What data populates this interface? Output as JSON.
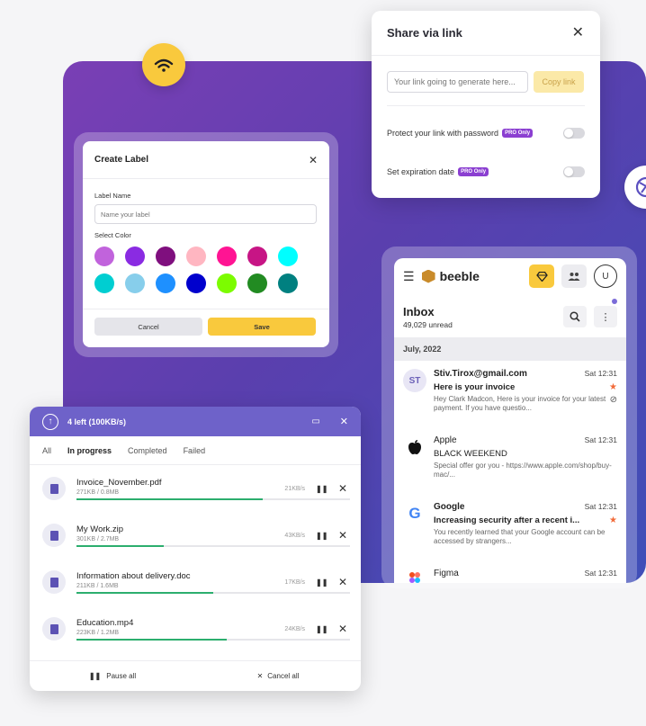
{
  "share": {
    "title": "Share via link",
    "link_placeholder": "Your link going to generate here...",
    "copy_label": "Copy link",
    "protect_label": "Protect your link with password",
    "expire_label": "Set expiration date",
    "pro_badge": "PRO Only"
  },
  "label_dialog": {
    "title": "Create Label",
    "name_label": "Label Name",
    "name_placeholder": "Name your label",
    "color_label": "Select Color",
    "colors": [
      "#c163dc",
      "#8a2be2",
      "#7f0f7e",
      "#ffb6c1",
      "#ff1493",
      "#c71585",
      "#00ffff",
      "#00ced1",
      "#87ceeb",
      "#1e90ff",
      "#0000cd",
      "#7cfc00",
      "#228b22",
      "#008080"
    ],
    "cancel": "Cancel",
    "save": "Save"
  },
  "mail": {
    "brand": "beeble",
    "avatar": "U",
    "inbox_title": "Inbox",
    "inbox_count": "49,029  unread",
    "month": "July, 2022",
    "items": [
      {
        "initials": "ST",
        "from": "Stiv.Tirox@gmail.com",
        "date": "Sat 12:31",
        "subject": "Here is your invoice",
        "preview": "Hey Clark Madcon, Here is your invoice for your latest payment. If you have questio..."
      },
      {
        "initials": "",
        "from": "Apple",
        "date": "Sat 12:31",
        "subject": "BLACK WEEKEND",
        "preview": "Special offer gor you - https://www.apple.com/shop/buy-mac/..."
      },
      {
        "initials": "G",
        "from": "Google",
        "date": "Sat 12:31",
        "subject": "Increasing security after a recent i...",
        "preview": "You recently learned that your Google account can be accessed by strangers..."
      },
      {
        "initials": "",
        "from": "Figma",
        "date": "Sat 12:31",
        "subject": "",
        "preview": ""
      }
    ]
  },
  "downloads": {
    "title": "4 left (100KB/s)",
    "tabs": [
      "All",
      "In progress",
      "Completed",
      "Failed"
    ],
    "files": [
      {
        "name": "Invoice_November.pdf",
        "size": "271KB / 0.8MB",
        "speed": "21KB/s",
        "progress": 0.68
      },
      {
        "name": "My Work.zip",
        "size": "301KB / 2.7MB",
        "speed": "43KB/s",
        "progress": 0.32
      },
      {
        "name": "Information about delivery.doc",
        "size": "211KB / 1.6MB",
        "speed": "17KB/s",
        "progress": 0.5
      },
      {
        "name": "Education.mp4",
        "size": "223KB / 1.2MB",
        "speed": "24KB/s",
        "progress": 0.55
      }
    ],
    "pause_all": "Pause all",
    "cancel_all": "Cancel all"
  }
}
